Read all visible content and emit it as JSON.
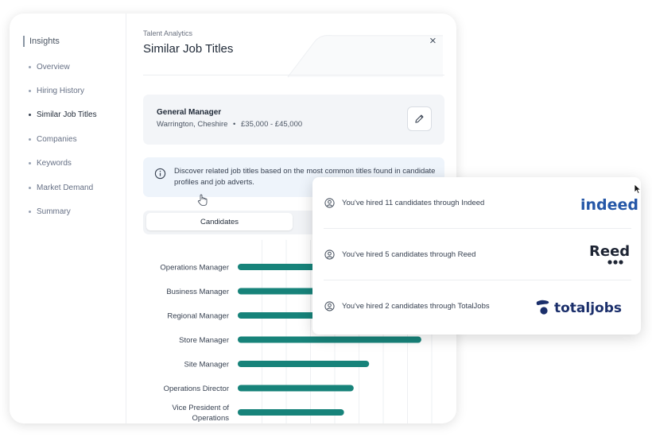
{
  "sidebar": {
    "heading": "Insights",
    "items": [
      {
        "label": "Overview",
        "active": false
      },
      {
        "label": "Hiring History",
        "active": false
      },
      {
        "label": "Similar Job Titles",
        "active": true
      },
      {
        "label": "Companies",
        "active": false
      },
      {
        "label": "Keywords",
        "active": false
      },
      {
        "label": "Market Demand",
        "active": false
      },
      {
        "label": "Summary",
        "active": false
      }
    ]
  },
  "header": {
    "eyebrow": "Talent Analytics",
    "title": "Similar Job Titles",
    "close_label": "×"
  },
  "job": {
    "title": "General Manager",
    "location": "Warrington, Cheshire",
    "separator": "•",
    "salary": "£35,000 - £45,000"
  },
  "info": {
    "text": "Discover related job titles based on the most common titles found in candidate profiles and job adverts."
  },
  "tabs": [
    {
      "label": "Candidates",
      "active": true
    }
  ],
  "chart_data": {
    "type": "bar",
    "orientation": "horizontal",
    "categories": [
      "Operations Manager",
      "Business Manager",
      "Regional Manager",
      "Store Manager",
      "Site Manager",
      "Operations Director",
      "Vice President of Operations"
    ],
    "values": [
      95,
      95,
      95,
      95,
      68,
      60,
      55
    ],
    "xlim": [
      0,
      100
    ],
    "grid": true,
    "color": "#17837a"
  },
  "popover": {
    "rows": [
      {
        "text": "You've hired 11 candidates through Indeed",
        "logo": "indeed"
      },
      {
        "text": "You've hired 5 candidates through Reed",
        "logo": "Reed"
      },
      {
        "text": "You've hired 2 candidates through TotalJobs",
        "logo": "totaljobs"
      }
    ]
  },
  "colors": {
    "accent": "#17837a",
    "indeed": "#2557a7",
    "reed": "#1d2433",
    "totaljobs": "#1b2f6b"
  },
  "icons": {
    "close": "close-icon",
    "edit": "pencil-icon",
    "info": "info-icon",
    "user": "user-circle-icon",
    "pointer": "hand-pointer-icon"
  }
}
